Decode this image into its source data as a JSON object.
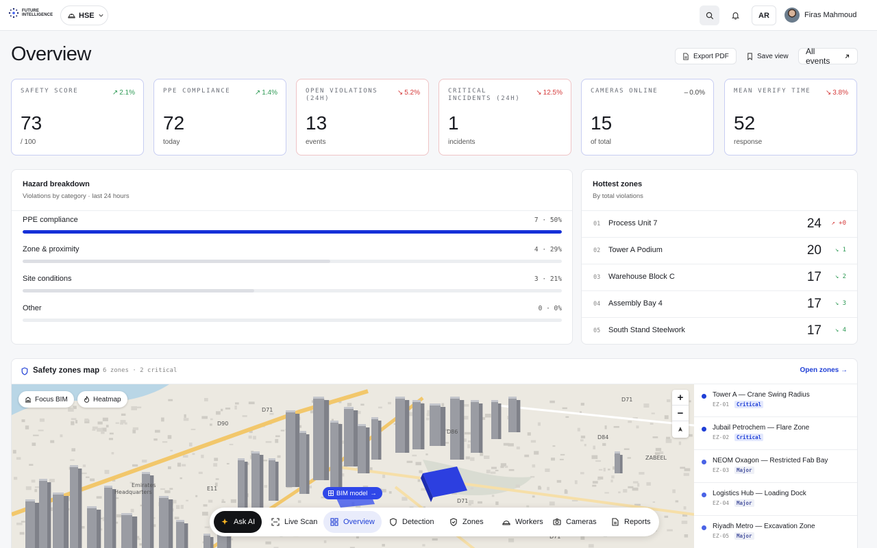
{
  "brand": {
    "line1": "FUTURE",
    "line2": "INTELLIGENCE"
  },
  "workspace": {
    "label": "HSE"
  },
  "header": {
    "lang": "AR",
    "user_name": "Firas Mahmoud"
  },
  "page": {
    "title": "Overview"
  },
  "actions": {
    "export": "Export PDF",
    "save": "Save view",
    "all_events": "All events"
  },
  "kpis": [
    {
      "label": "SAFETY SCORE",
      "delta": "2.1%",
      "trend": "up",
      "value": "73",
      "sub": "/ 100"
    },
    {
      "label": "PPE COMPLIANCE",
      "delta": "1.4%",
      "trend": "up",
      "value": "72",
      "sub": "today"
    },
    {
      "label": "OPEN VIOLATIONS (24H)",
      "delta": "5.2%",
      "trend": "down",
      "value": "13",
      "sub": "events"
    },
    {
      "label": "CRITICAL INCIDENTS (24H)",
      "delta": "12.5%",
      "trend": "down",
      "value": "1",
      "sub": "incidents"
    },
    {
      "label": "CAMERAS ONLINE",
      "delta": "0.0%",
      "trend": "flat",
      "value": "15",
      "sub": "of total"
    },
    {
      "label": "MEAN VERIFY TIME",
      "delta": "3.8%",
      "trend": "down",
      "value": "52",
      "sub": "response"
    }
  ],
  "hazard": {
    "title": "Hazard breakdown",
    "subtitle": "Violations by category · last 24 hours",
    "rows": [
      {
        "name": "PPE compliance",
        "count": "7",
        "pct": "50%",
        "share": 1.0,
        "color": "#1630d8"
      },
      {
        "name": "Zone & proximity",
        "count": "4",
        "pct": "29%",
        "share": 0.57,
        "color": "#e3e5e9"
      },
      {
        "name": "Site conditions",
        "count": "3",
        "pct": "21%",
        "share": 0.43,
        "color": "#e3e5e9"
      },
      {
        "name": "Other",
        "count": "0",
        "pct": "0%",
        "share": 0.0,
        "color": "#e3e5e9"
      }
    ]
  },
  "hottest": {
    "title": "Hottest zones",
    "subtitle": "By total violations",
    "rows": [
      {
        "rank": "01",
        "name": "Process Unit 7",
        "count": "24",
        "delta": "+0",
        "trend": "up"
      },
      {
        "rank": "02",
        "name": "Tower A Podium",
        "count": "20",
        "delta": "1",
        "trend": "down"
      },
      {
        "rank": "03",
        "name": "Warehouse Block C",
        "count": "17",
        "delta": "2",
        "trend": "down"
      },
      {
        "rank": "04",
        "name": "Assembly Bay 4",
        "count": "17",
        "delta": "3",
        "trend": "down"
      },
      {
        "rank": "05",
        "name": "South Stand Steelwork",
        "count": "17",
        "delta": "4",
        "trend": "down"
      }
    ]
  },
  "map": {
    "title": "Safety zones map",
    "meta": "6 zones · 2 critical",
    "open_label": "Open zones",
    "chips": {
      "focus": "Focus BIM",
      "heatmap": "Heatmap"
    },
    "bim_label": "BIM model",
    "labels": [
      "Emirates",
      "Headquarters",
      "E11",
      "E11",
      "E11",
      "D90",
      "D71",
      "D71",
      "D71",
      "D71",
      "D86",
      "D84",
      "ZABEEL"
    ],
    "zones": [
      {
        "name": "Tower A — Crane Swing Radius",
        "code": "EZ-01",
        "severity": "Critical",
        "dot": "#1f3fd6"
      },
      {
        "name": "Jubail Petrochem — Flare Zone",
        "code": "EZ-02",
        "severity": "Critical",
        "dot": "#1f3fd6"
      },
      {
        "name": "NEOM Oxagon — Restricted Fab Bay",
        "code": "EZ-03",
        "severity": "Major",
        "dot": "#4a63e6"
      },
      {
        "name": "Logistics Hub — Loading Dock",
        "code": "EZ-04",
        "severity": "Major",
        "dot": "#4a63e6"
      },
      {
        "name": "Riyadh Metro — Excavation Zone",
        "code": "EZ-05",
        "severity": "Major",
        "dot": "#4a63e6"
      }
    ]
  },
  "dock": {
    "items": [
      {
        "label": "Ask AI",
        "icon": "sparkle-icon"
      },
      {
        "label": "Live Scan",
        "icon": "scan-icon"
      },
      {
        "label": "Overview",
        "icon": "grid-icon"
      },
      {
        "label": "Detection",
        "icon": "shield-icon"
      },
      {
        "label": "Zones",
        "icon": "shield-check-icon"
      },
      {
        "label": "Workers",
        "icon": "hardhat-icon"
      },
      {
        "label": "Cameras",
        "icon": "camera-icon"
      },
      {
        "label": "Reports",
        "icon": "document-icon"
      }
    ]
  },
  "colors": {
    "accent": "#1f3fd6",
    "up": "#2e9a55",
    "down": "#d53a3a"
  }
}
